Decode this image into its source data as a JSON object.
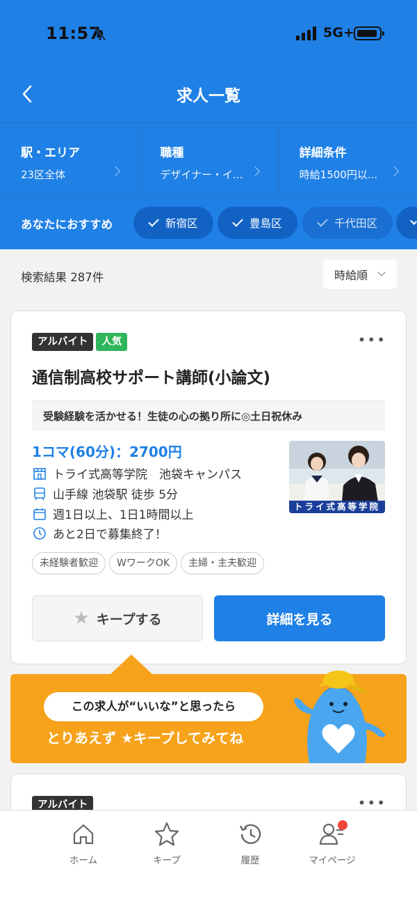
{
  "status_bar": {
    "time": "11:57",
    "network": "5G+"
  },
  "nav": {
    "title": "求人一覧"
  },
  "filters": [
    {
      "label": "駅・エリア",
      "value": "23区全体"
    },
    {
      "label": "職種",
      "value": "デザイナー・イ..."
    },
    {
      "label": "詳細条件",
      "value": "時給1500円以..."
    }
  ],
  "recommend": {
    "label": "あなたにおすすめ",
    "chips": [
      "新宿区",
      "豊島区",
      "千代田区"
    ]
  },
  "results": {
    "count_text": "検索結果 287件",
    "sort_label": "時給順"
  },
  "job": {
    "tags": [
      "アルバイト",
      "人気"
    ],
    "title": "通信制高校サポート講師(小論文)",
    "catch": "受験経験を活かせる！生徒の心の拠り所に◎土日祝休み",
    "wage": "1コマ(60分)：2700円",
    "company": "トライ式高等学院　池袋キャンパス",
    "access": "山手線 池袋駅 徒歩 5分",
    "shift": "週1日以上、1日1時間以上",
    "deadline": "あと2日で募集終了！",
    "photo_caption": "トライ式高等学院",
    "features": [
      "未経験者歓迎",
      "WワークOK",
      "主婦・主夫歓迎"
    ],
    "keep_label": "キープする",
    "detail_label": "詳細を見る"
  },
  "banner": {
    "bubble_text": "この求人が“いいな”と思ったら",
    "line2": "とりあえず ★キープしてみてね"
  },
  "job2": {
    "tag": "アルバイト"
  },
  "tabbar": [
    {
      "label": "ホーム",
      "icon": "home-icon"
    },
    {
      "label": "キープ",
      "icon": "star-icon"
    },
    {
      "label": "履歴",
      "icon": "history-icon"
    },
    {
      "label": "マイページ",
      "icon": "user-icon"
    }
  ],
  "colors": {
    "primary": "#1f80e6",
    "accent_orange": "#f7a21b",
    "popular_green": "#2fb55b",
    "badge_red": "#f0463c"
  }
}
